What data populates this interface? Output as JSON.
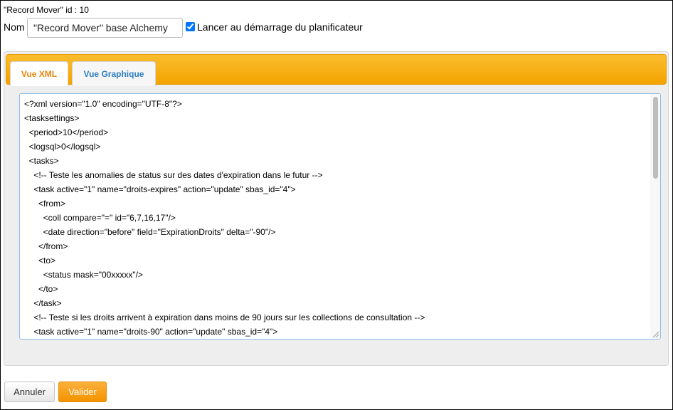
{
  "header": {
    "title": "\"Record Mover\" id : 10",
    "name_label": "Nom",
    "name_value": "\"Record Mover\" base Alchemy",
    "startup_checkbox_checked": true,
    "startup_label": "Lancer au démarrage du planificateur"
  },
  "tabs": [
    {
      "label": "Vue XML",
      "active": true
    },
    {
      "label": "Vue Graphique",
      "active": false
    }
  ],
  "editor": {
    "lines": [
      "<?xml version=\"1.0\" encoding=\"UTF-8\"?>",
      "<tasksettings>",
      "  <period>10</period>",
      "  <logsql>0</logsql>",
      "  <tasks>",
      "    <!-- Teste les anomalies de status sur des dates d'expiration dans le futur -->",
      "    <task active=\"1\" name=\"droits-expires\" action=\"update\" sbas_id=\"4\">",
      "      <from>",
      "        <coll compare=\"=\" id=\"6,7,16,17\"/>",
      "        <date direction=\"before\" field=\"ExpirationDroits\" delta=\"-90\"/>",
      "      </from>",
      "      <to>",
      "        <status mask=\"00xxxxx\"/>",
      "      </to>",
      "    </task>",
      "    <!-- Teste si les droits arrivent à expiration dans moins de 90 jours sur les collections de consultation -->",
      "    <task active=\"1\" name=\"droits-90\" action=\"update\" sbas_id=\"4\">"
    ]
  },
  "buttons": {
    "cancel": "Annuler",
    "submit": "Valider"
  },
  "colors": {
    "tab_bar": "#f5a800",
    "active_tab_text": "#e6860c",
    "inactive_tab_text": "#2d7ec1",
    "submit_button": "#f39200",
    "editor_border": "#8fbde6"
  }
}
